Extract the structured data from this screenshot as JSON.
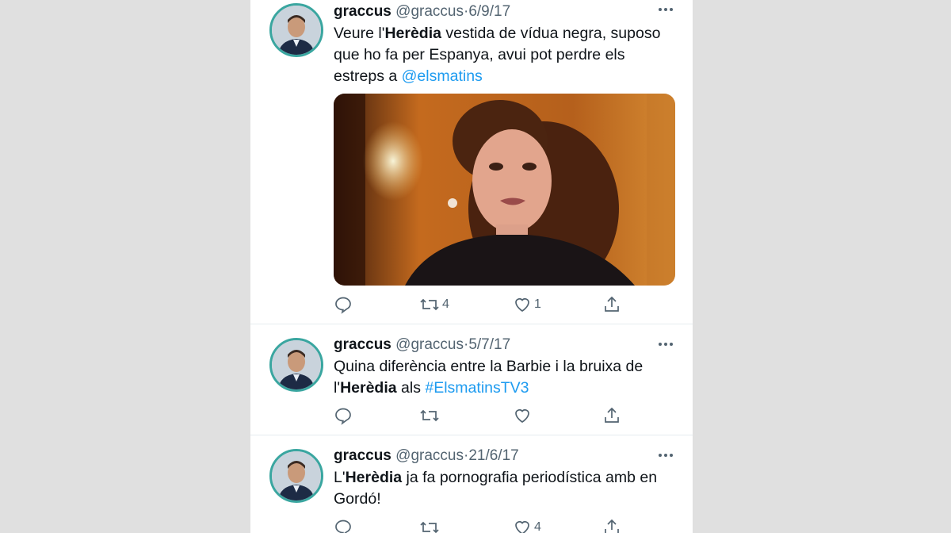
{
  "tweets": [
    {
      "name": "graccus",
      "handle": "@graccus",
      "separator": "·",
      "date": "6/9/17",
      "text": {
        "part1": "Veure l'",
        "bold": "Herèdia",
        "part2": " vestida de vídua negra, suposo que ho fa per Espanya, avui pot perdre els estreps a ",
        "link": "@elsmatins"
      },
      "has_media": true,
      "reply_count": "",
      "retweet_count": "4",
      "like_count": "1"
    },
    {
      "name": "graccus",
      "handle": "@graccus",
      "separator": "·",
      "date": "5/7/17",
      "text": {
        "part1": "Quina diferència entre la Barbie i la bruixa de l'",
        "bold": "Herèdia",
        "part2": " als ",
        "link": "#ElsmatinsTV3"
      },
      "has_media": false,
      "reply_count": "",
      "retweet_count": "",
      "like_count": ""
    },
    {
      "name": "graccus",
      "handle": "@graccus",
      "separator": "·",
      "date": "21/6/17",
      "text": {
        "part1": "L'",
        "bold": "Herèdia",
        "part2": " ja fa pornografia periodística amb en Gordó!",
        "link": ""
      },
      "has_media": false,
      "reply_count": "",
      "retweet_count": "",
      "like_count": "4"
    }
  ],
  "icons": {
    "reply": "reply-icon",
    "retweet": "retweet-icon",
    "like": "heart-icon",
    "share": "share-icon",
    "more": "more-icon"
  },
  "colors": {
    "link": "#1d9bf0",
    "avatar_ring": "#3aa6a0",
    "secondary_text": "#536471"
  }
}
